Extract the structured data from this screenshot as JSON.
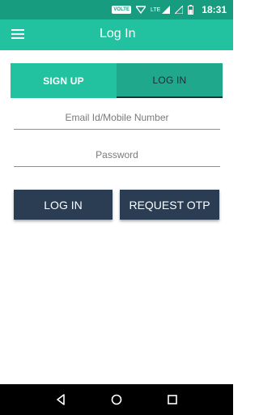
{
  "status_bar": {
    "volte_label": "VOLTE",
    "network_label": "LTE",
    "time": "18:31",
    "icons": [
      "wifi-icon",
      "signal-icon",
      "battery-icon"
    ]
  },
  "app_bar": {
    "title": "Log In",
    "menu_icon": "hamburger-menu-icon"
  },
  "tabs": [
    {
      "label": "SIGN UP",
      "active": false
    },
    {
      "label": "LOG IN",
      "active": true
    }
  ],
  "form": {
    "email_placeholder": "Email Id/Mobile Number",
    "email_value": "",
    "password_placeholder": "Password",
    "password_value": ""
  },
  "buttons": {
    "login_label": "LOG IN",
    "otp_label": "REQUEST OTP"
  },
  "nav_bar": {
    "icons": [
      "back-icon",
      "home-icon",
      "recents-icon"
    ]
  },
  "colors": {
    "status_bar": "#179c80",
    "app_bar": "#22c19f",
    "button": "#2b3d52"
  }
}
